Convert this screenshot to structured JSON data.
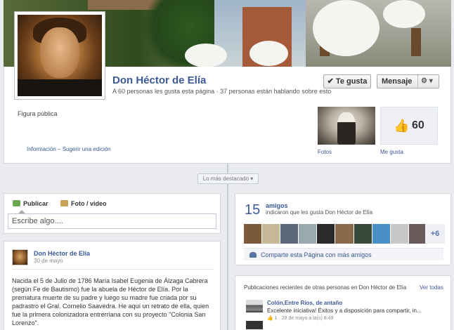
{
  "page": {
    "name": "Don Héctor de Elía",
    "stats": "A 60 personas les gusta esta página · 37 personas están hablando sobre esto",
    "category": "Figura pública",
    "info_link": "Información – Sugerir una edición"
  },
  "actions": {
    "like_label": "Te gusta",
    "like_check": "✔",
    "message_label": "Mensaje",
    "gear_label": "⚙ ▾"
  },
  "tiles": {
    "photos_label": "Fotos",
    "likes_label": "Me gusta",
    "likes_count": "60"
  },
  "timeline": {
    "highlights_label": "Lo más destacado ▾"
  },
  "composer": {
    "tab_publish": "Publicar",
    "tab_photo": "Foto / video",
    "placeholder": "Escribe algo...."
  },
  "post": {
    "author": "Don Héctor de Elía",
    "date": "30 de mayo",
    "body": "Nacida el 5 de Julio de 1786 María Isabel Eugenia de Álzaga Cabrera (según Fe de Bautismo) fue la abuela de Héctor de Elía. Por la prematura muerte de su padre y luego su madre fue criada por su padrastro el Gral. Cornelio Saavedra. He aquí un retrato de ella, quien fue la primera colonizadora entrerriana con su proyecto \"Colonia San Lorenzo\"."
  },
  "friends": {
    "count": "15",
    "label": "amigos",
    "sub": "indicaron que les gusta Don Héctor de Elía",
    "more": "+6",
    "share": "Comparte esta Página con más amigos",
    "strip_colors": [
      "#7a5a3a",
      "#c8b89a",
      "#5a6a7a",
      "#9aa8b0",
      "#2a2a2a",
      "#8a6a4a",
      "#3a4a3a",
      "#4a90c8",
      "#c8c8c8",
      "#6a5a5a"
    ]
  },
  "recent": {
    "header": "Publicaciones recientes de otras personas en Don Héctor de Elía",
    "see_all": "Ver todas",
    "item_author": "Colón,Entre Ríos, de antaño",
    "item_text": "Excelente iniciativa! Éxitos y a disposición para compartir, in...",
    "item_likes": "1",
    "item_meta": "· 28 de mayo a la(s) 8:49"
  }
}
